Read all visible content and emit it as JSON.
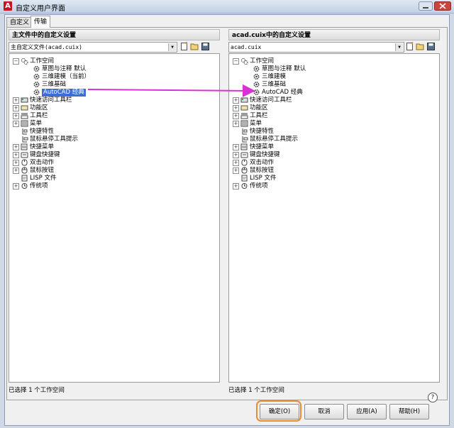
{
  "window": {
    "title": "自定义用户界面"
  },
  "tabs": [
    {
      "label": "自定义",
      "active": false
    },
    {
      "label": "传输",
      "active": true
    }
  ],
  "left_panel": {
    "header": "主文件中的自定义设置",
    "combo_value": "主自定义文件(acad.cuix)",
    "status": "已选择 1 个工作空间"
  },
  "right_panel": {
    "header": "acad.cuix中的自定义设置",
    "combo_value": "acad.cuix",
    "status": "已选择 1 个工作空间"
  },
  "left_tree": [
    {
      "label": "工作空间",
      "level": 0,
      "expander": "-",
      "icon": "workspaces-icon"
    },
    {
      "label": "草图与注释 默认",
      "level": 1,
      "icon": "gear-icon"
    },
    {
      "label": "三维建模（当前）",
      "level": 1,
      "icon": "gear-icon"
    },
    {
      "label": "三维基础",
      "level": 1,
      "icon": "gear-icon"
    },
    {
      "label": "AutoCAD 经典",
      "level": 1,
      "icon": "gear-icon",
      "selected": true
    },
    {
      "label": "快速访问工具栏",
      "level": 0,
      "expander": "+",
      "icon": "quick-access-toolbar-icon"
    },
    {
      "label": "功能区",
      "level": 0,
      "expander": "+",
      "icon": "ribbon-icon"
    },
    {
      "label": "工具栏",
      "level": 0,
      "expander": "+",
      "icon": "toolbar-icon"
    },
    {
      "label": "菜单",
      "level": 0,
      "expander": "+",
      "icon": "menu-icon"
    },
    {
      "label": "快捷特性",
      "level": 0,
      "icon": "quick-properties-icon"
    },
    {
      "label": "鼠标悬停工具提示",
      "level": 0,
      "icon": "rollover-tooltip-icon"
    },
    {
      "label": "快捷菜单",
      "level": 0,
      "expander": "+",
      "icon": "shortcut-menu-icon"
    },
    {
      "label": "键盘快捷键",
      "level": 0,
      "expander": "+",
      "icon": "keyboard-shortcut-icon"
    },
    {
      "label": "双击动作",
      "level": 0,
      "expander": "+",
      "icon": "double-click-icon"
    },
    {
      "label": "鼠标按钮",
      "level": 0,
      "expander": "+",
      "icon": "mouse-button-icon"
    },
    {
      "label": "LISP 文件",
      "level": 0,
      "icon": "lisp-file-icon"
    },
    {
      "label": "传统项",
      "level": 0,
      "expander": "+",
      "icon": "legacy-icon"
    }
  ],
  "right_tree": [
    {
      "label": "工作空间",
      "level": 0,
      "expander": "-",
      "icon": "workspaces-icon"
    },
    {
      "label": "草图与注释 默认",
      "level": 1,
      "icon": "gear-icon"
    },
    {
      "label": "三维建模",
      "level": 1,
      "icon": "gear-icon"
    },
    {
      "label": "三维基础",
      "level": 1,
      "icon": "gear-icon"
    },
    {
      "label": "AutoCAD 经典",
      "level": 1,
      "icon": "gear-icon"
    },
    {
      "label": "快速访问工具栏",
      "level": 0,
      "expander": "+",
      "icon": "quick-access-toolbar-icon"
    },
    {
      "label": "功能区",
      "level": 0,
      "expander": "+",
      "icon": "ribbon-icon"
    },
    {
      "label": "工具栏",
      "level": 0,
      "expander": "+",
      "icon": "toolbar-icon"
    },
    {
      "label": "菜单",
      "level": 0,
      "expander": "+",
      "icon": "menu-icon"
    },
    {
      "label": "快捷特性",
      "level": 0,
      "icon": "quick-properties-icon"
    },
    {
      "label": "鼠标悬停工具提示",
      "level": 0,
      "icon": "rollover-tooltip-icon"
    },
    {
      "label": "快捷菜单",
      "level": 0,
      "expander": "+",
      "icon": "shortcut-menu-icon"
    },
    {
      "label": "键盘快捷键",
      "level": 0,
      "expander": "+",
      "icon": "keyboard-shortcut-icon"
    },
    {
      "label": "双击动作",
      "level": 0,
      "expander": "+",
      "icon": "double-click-icon"
    },
    {
      "label": "鼠标按钮",
      "level": 0,
      "expander": "+",
      "icon": "mouse-button-icon"
    },
    {
      "label": "LISP 文件",
      "level": 0,
      "icon": "lisp-file-icon"
    },
    {
      "label": "传统项",
      "level": 0,
      "expander": "+",
      "icon": "legacy-icon"
    }
  ],
  "buttons": {
    "ok": "确定(O)",
    "cancel": "取消",
    "apply": "应用(A)",
    "help": "帮助(H)"
  },
  "colors": {
    "annotation_arrow": "#d932d4",
    "ok_highlight": "#ea8c2f",
    "selection": "#3b6fd6"
  }
}
